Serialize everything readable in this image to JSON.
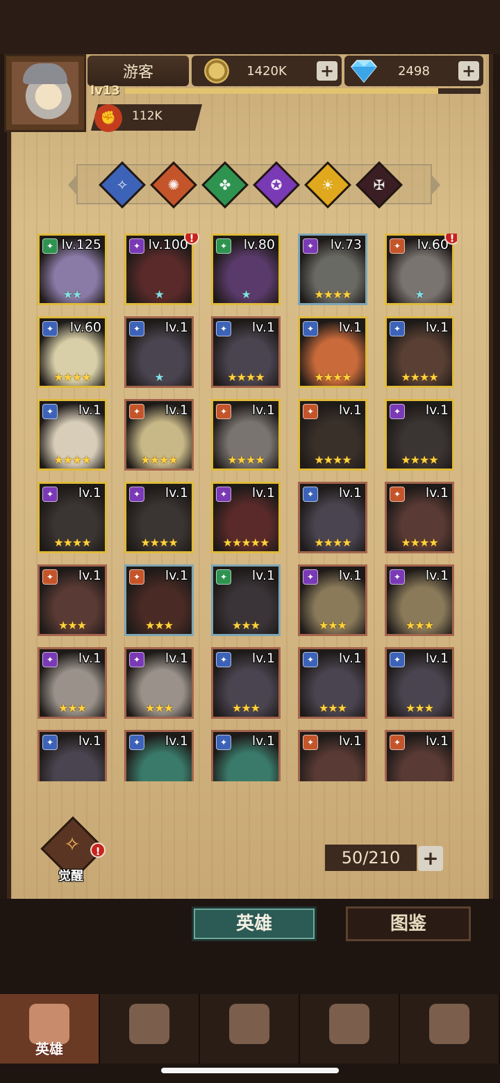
{
  "player": {
    "name": "游客",
    "level": "lv13",
    "exp_fraction": 0.88,
    "power": "112K"
  },
  "currency": {
    "gold": "1420K",
    "gems": "2498"
  },
  "filters": [
    {
      "name": "class-filter-blue",
      "color": "#3d63b8",
      "glyph": "✧"
    },
    {
      "name": "class-filter-orange",
      "color": "#c4552a",
      "glyph": "✺"
    },
    {
      "name": "class-filter-green",
      "color": "#2f9350",
      "glyph": "✤"
    },
    {
      "name": "class-filter-purple",
      "color": "#7a3ab5",
      "glyph": "✪"
    },
    {
      "name": "class-filter-yellow",
      "color": "#e0a81c",
      "glyph": "☀"
    },
    {
      "name": "class-filter-dark",
      "color": "#3a1e24",
      "glyph": "✠"
    }
  ],
  "heroes": [
    {
      "level": "lv.125",
      "stars": "★★",
      "star_color": "blue",
      "frame": "gold",
      "class_color": "#2f9350",
      "tint": "#8a7aa6",
      "alert": false
    },
    {
      "level": "lv.100",
      "stars": "★",
      "star_color": "blue",
      "frame": "gold",
      "class_color": "#7a3ab5",
      "tint": "#5a2a2a",
      "alert": true
    },
    {
      "level": "lv.80",
      "stars": "★",
      "star_color": "blue",
      "frame": "gold",
      "class_color": "#2f9350",
      "tint": "#5a3a6a",
      "alert": false
    },
    {
      "level": "lv.73",
      "stars": "★★★★",
      "star_color": "gold",
      "frame": "blue",
      "class_color": "#7a3ab5",
      "tint": "#6a6a64",
      "alert": false
    },
    {
      "level": "lv.60",
      "stars": "★",
      "star_color": "blue",
      "frame": "gold",
      "class_color": "#c4552a",
      "tint": "#7a7470",
      "alert": true
    },
    {
      "level": "lv.60",
      "stars": "★★★★",
      "star_color": "gold",
      "frame": "gold",
      "class_color": "#3d63b8",
      "tint": "#d8cfa8",
      "alert": false
    },
    {
      "level": "lv.1",
      "stars": "★",
      "star_color": "blue",
      "frame": "red",
      "class_color": "#3d63b8",
      "tint": "#4a4450",
      "alert": false
    },
    {
      "level": "lv.1",
      "stars": "★★★★",
      "star_color": "gold",
      "frame": "red",
      "class_color": "#3d63b8",
      "tint": "#4a4450",
      "alert": false
    },
    {
      "level": "lv.1",
      "stars": "★★★★",
      "star_color": "gold",
      "frame": "gold",
      "class_color": "#3d63b8",
      "tint": "#c86a3a",
      "alert": false
    },
    {
      "level": "lv.1",
      "stars": "★★★★",
      "star_color": "gold",
      "frame": "gold",
      "class_color": "#3d63b8",
      "tint": "#5a4034",
      "alert": false
    },
    {
      "level": "lv.1",
      "stars": "★★★★",
      "star_color": "gold",
      "frame": "gold",
      "class_color": "#3d63b8",
      "tint": "#d8cdb8",
      "alert": false
    },
    {
      "level": "lv.1",
      "stars": "★★★★",
      "star_color": "gold",
      "frame": "red",
      "class_color": "#c4552a",
      "tint": "#c8b888",
      "alert": false
    },
    {
      "level": "lv.1",
      "stars": "★★★★",
      "star_color": "gold",
      "frame": "gold",
      "class_color": "#c4552a",
      "tint": "#7a7470",
      "alert": false
    },
    {
      "level": "lv.1",
      "stars": "★★★★",
      "star_color": "gold",
      "frame": "gold",
      "class_color": "#c4552a",
      "tint": "#3a302a",
      "alert": false
    },
    {
      "level": "lv.1",
      "stars": "★★★★",
      "star_color": "gold",
      "frame": "gold",
      "class_color": "#7a3ab5",
      "tint": "#3a3432",
      "alert": false
    },
    {
      "level": "lv.1",
      "stars": "★★★★",
      "star_color": "gold",
      "frame": "gold",
      "class_color": "#7a3ab5",
      "tint": "#3a3432",
      "alert": false
    },
    {
      "level": "lv.1",
      "stars": "★★★★",
      "star_color": "gold",
      "frame": "gold",
      "class_color": "#7a3ab5",
      "tint": "#3a3432",
      "alert": false
    },
    {
      "level": "lv.1",
      "stars": "★★★★★",
      "star_color": "gold",
      "frame": "gold",
      "class_color": "#7a3ab5",
      "tint": "#5a2a2a",
      "alert": false
    },
    {
      "level": "lv.1",
      "stars": "★★★★",
      "star_color": "gold",
      "frame": "red",
      "class_color": "#3d63b8",
      "tint": "#4a4450",
      "alert": false
    },
    {
      "level": "lv.1",
      "stars": "★★★★",
      "star_color": "gold",
      "frame": "red",
      "class_color": "#c4552a",
      "tint": "#5a3a34",
      "alert": false
    },
    {
      "level": "lv.1",
      "stars": "★★★",
      "star_color": "gold",
      "frame": "red",
      "class_color": "#c4552a",
      "tint": "#5a3a34",
      "alert": false
    },
    {
      "level": "lv.1",
      "stars": "★★★",
      "star_color": "gold",
      "frame": "blue",
      "class_color": "#c4552a",
      "tint": "#4a2a24",
      "alert": false
    },
    {
      "level": "lv.1",
      "stars": "★★★",
      "star_color": "gold",
      "frame": "blue",
      "class_color": "#2f9350",
      "tint": "#3a3438",
      "alert": false
    },
    {
      "level": "lv.1",
      "stars": "★★★",
      "star_color": "gold",
      "frame": "red",
      "class_color": "#7a3ab5",
      "tint": "#8a7a5a",
      "alert": false
    },
    {
      "level": "lv.1",
      "stars": "★★★",
      "star_color": "gold",
      "frame": "red",
      "class_color": "#7a3ab5",
      "tint": "#8a7a5a",
      "alert": false
    },
    {
      "level": "lv.1",
      "stars": "★★★",
      "star_color": "gold",
      "frame": "red",
      "class_color": "#7a3ab5",
      "tint": "#9a928a",
      "alert": false
    },
    {
      "level": "lv.1",
      "stars": "★★★",
      "star_color": "gold",
      "frame": "red",
      "class_color": "#7a3ab5",
      "tint": "#9a928a",
      "alert": false
    },
    {
      "level": "lv.1",
      "stars": "★★★",
      "star_color": "gold",
      "frame": "red",
      "class_color": "#3d63b8",
      "tint": "#4a4450",
      "alert": false
    },
    {
      "level": "lv.1",
      "stars": "★★★",
      "star_color": "gold",
      "frame": "red",
      "class_color": "#3d63b8",
      "tint": "#4a4450",
      "alert": false
    },
    {
      "level": "lv.1",
      "stars": "★★★",
      "star_color": "gold",
      "frame": "red",
      "class_color": "#3d63b8",
      "tint": "#4a4450",
      "alert": false
    },
    {
      "level": "lv.1",
      "stars": "",
      "star_color": "gold",
      "frame": "red",
      "class_color": "#3d63b8",
      "tint": "#4a4450",
      "alert": false
    },
    {
      "level": "lv.1",
      "stars": "",
      "star_color": "gold",
      "frame": "red",
      "class_color": "#3d63b8",
      "tint": "#3a7a6a",
      "alert": false
    },
    {
      "level": "lv.1",
      "stars": "",
      "star_color": "gold",
      "frame": "red",
      "class_color": "#3d63b8",
      "tint": "#3a7a6a",
      "alert": false
    },
    {
      "level": "lv.1",
      "stars": "",
      "star_color": "gold",
      "frame": "red",
      "class_color": "#c4552a",
      "tint": "#5a3a34",
      "alert": false
    },
    {
      "level": "lv.1",
      "stars": "",
      "star_color": "gold",
      "frame": "red",
      "class_color": "#c4552a",
      "tint": "#5a3a34",
      "alert": false
    }
  ],
  "awaken": {
    "label": "觉醒",
    "alert": true
  },
  "roster_count": "50/210",
  "tabs": {
    "hero": "英雄",
    "codex": "图鉴"
  },
  "nav": [
    {
      "label": "英雄",
      "icon": "hero-helmet-icon",
      "active": true
    },
    {
      "label": "",
      "icon": "adventure-banner-icon",
      "active": false
    },
    {
      "label": "",
      "icon": "battle-crossed-swords-icon",
      "active": false
    },
    {
      "label": "",
      "icon": "castle-tower-icon",
      "active": false
    },
    {
      "label": "",
      "icon": "guild-handshake-icon",
      "active": false
    }
  ]
}
